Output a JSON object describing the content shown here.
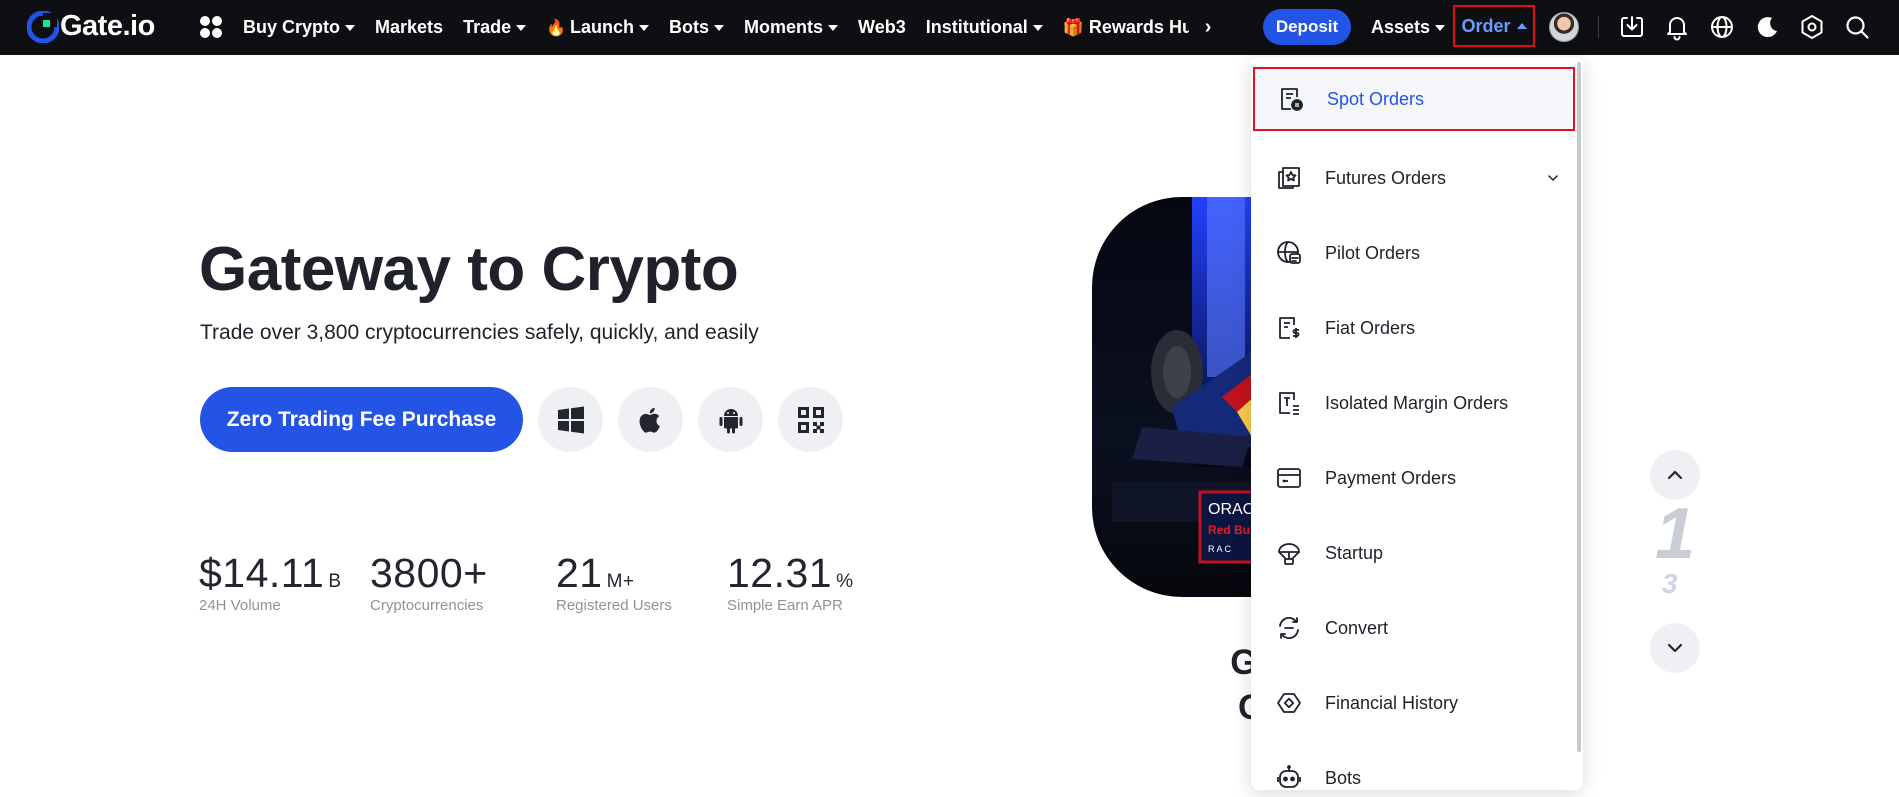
{
  "brand": {
    "name": "Gate.io"
  },
  "nav": {
    "items": [
      {
        "label": "Buy Crypto",
        "caret": true
      },
      {
        "label": "Markets",
        "caret": false
      },
      {
        "label": "Trade",
        "caret": true
      },
      {
        "label": "Launch",
        "caret": true
      },
      {
        "label": "Bots",
        "caret": true
      },
      {
        "label": "Moments",
        "caret": true
      },
      {
        "label": "Web3",
        "caret": false
      },
      {
        "label": "Institutional",
        "caret": true
      },
      {
        "label": "Rewards Hub",
        "caret": false
      }
    ],
    "more": "›"
  },
  "topbar": {
    "deposit_label": "Deposit",
    "assets_label": "Assets",
    "order_label": "Order"
  },
  "hero": {
    "title": "Gateway to Crypto",
    "subtitle": "Trade over 3,800 cryptocurrencies safely, quickly, and easily",
    "cta_label": "Zero Trading Fee Purchase"
  },
  "stats": [
    {
      "value": "$14.11",
      "unit": "B",
      "label": "24H Volume"
    },
    {
      "value": "3800+",
      "unit": "",
      "label": "Cryptocurrencies"
    },
    {
      "value": "21",
      "unit": "M+",
      "label": "Registered Users"
    },
    {
      "value": "12.31",
      "unit": "%",
      "label": "Simple Earn APR"
    }
  ],
  "banner": {
    "line1": "Gate.io, T",
    "line2": "Oracle R",
    "badge_top": "ORAC",
    "badge_mid": "Red Bull",
    "badge_bot": "R A C"
  },
  "carousel": {
    "current": "1",
    "total": "3"
  },
  "order_menu": {
    "items": [
      {
        "label": "Spot Orders",
        "icon": "spot-orders-icon"
      },
      {
        "label": "Futures Orders",
        "icon": "futures-orders-icon"
      },
      {
        "label": "Pilot Orders",
        "icon": "pilot-orders-icon"
      },
      {
        "label": "Fiat Orders",
        "icon": "fiat-orders-icon"
      },
      {
        "label": "Isolated Margin Orders",
        "icon": "margin-orders-icon"
      },
      {
        "label": "Payment Orders",
        "icon": "payment-orders-icon"
      },
      {
        "label": "Startup",
        "icon": "startup-icon"
      },
      {
        "label": "Convert",
        "icon": "convert-icon"
      },
      {
        "label": "Financial History",
        "icon": "financial-history-icon"
      },
      {
        "label": "Bots",
        "icon": "bots-icon"
      }
    ]
  },
  "colors": {
    "topbar_bg": "#0e0f12",
    "accent_blue": "#2354e6",
    "highlight_red": "#e3101c",
    "order_active": "#6a9bff"
  }
}
